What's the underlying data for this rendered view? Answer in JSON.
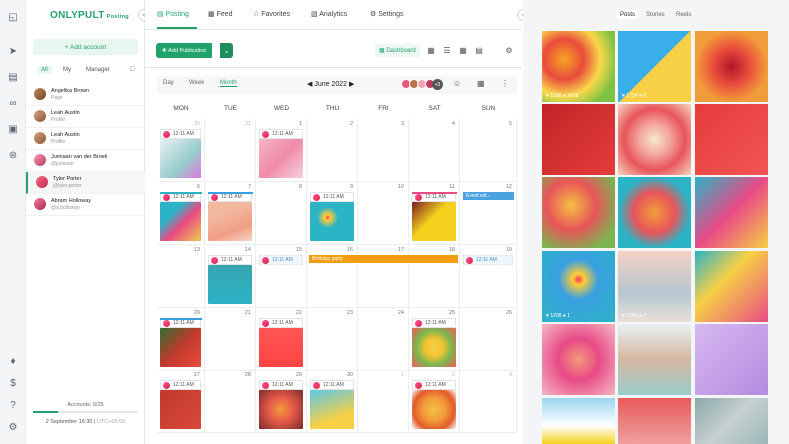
{
  "brand": {
    "name": "ONLYPULT",
    "suffix": "Posting",
    "accent": "#22a36c"
  },
  "rail_icons": [
    "camera-icon",
    "send-icon",
    "analytics-icon",
    "link-icon",
    "monitor-icon",
    "broadcast-icon",
    "bell-icon",
    "dollar-icon",
    "help-icon",
    "settings-icon"
  ],
  "accounts_panel": {
    "add_label": "+ Add account",
    "filters": [
      "All",
      "My",
      "Manager"
    ],
    "items": [
      {
        "name": "Angelika Brown",
        "sub": "Page"
      },
      {
        "name": "Leah Austin",
        "sub": "Profile"
      },
      {
        "name": "Leah Austin",
        "sub": "Profile"
      },
      {
        "name": "Jumiaan van der Broek",
        "sub": "@jumiaan"
      },
      {
        "name": "Tyler Porter",
        "sub": "@tyler.porter"
      },
      {
        "name": "Abram Holloway",
        "sub": "@a.holloway"
      }
    ],
    "footer": {
      "count": "Accounts: 6/25",
      "date": "2 September 16:30",
      "tz": "UTC+05:00"
    }
  },
  "nav": {
    "tabs": [
      {
        "label": "Posting",
        "icon": "posting-icon"
      },
      {
        "label": "Feed",
        "icon": "feed-icon"
      },
      {
        "label": "Favorites",
        "icon": "star-icon"
      },
      {
        "label": "Analytics",
        "icon": "analytics-icon"
      },
      {
        "label": "Settings",
        "icon": "gear-icon"
      }
    ]
  },
  "toolbar": {
    "add_publication": "Add Publication",
    "dashboard": "Dashboard"
  },
  "calendar": {
    "views": [
      "Day",
      "Week",
      "Month"
    ],
    "month_label": "June 2022",
    "extra_accounts": "+3",
    "weekdays": [
      "MON",
      "TUE",
      "WED",
      "THU",
      "FRI",
      "SAT",
      "SUN"
    ],
    "weeks": [
      [
        {
          "d": "30",
          "f": true
        },
        {
          "d": "31",
          "f": true
        },
        {
          "d": "1"
        },
        {
          "d": "2"
        },
        {
          "d": "3"
        },
        {
          "d": "4"
        },
        {
          "d": "5"
        }
      ],
      [
        {
          "d": "6"
        },
        {
          "d": "7"
        },
        {
          "d": "8"
        },
        {
          "d": "9"
        },
        {
          "d": "10"
        },
        {
          "d": "11"
        },
        {
          "d": "12"
        }
      ],
      [
        {
          "d": "13"
        },
        {
          "d": "14"
        },
        {
          "d": "15"
        },
        {
          "d": "16"
        },
        {
          "d": "17"
        },
        {
          "d": "18"
        },
        {
          "d": "19"
        }
      ],
      [
        {
          "d": "20"
        },
        {
          "d": "21"
        },
        {
          "d": "22"
        },
        {
          "d": "23"
        },
        {
          "d": "24"
        },
        {
          "d": "25"
        },
        {
          "d": "26"
        }
      ],
      [
        {
          "d": "27"
        },
        {
          "d": "28"
        },
        {
          "d": "29"
        },
        {
          "d": "30"
        },
        {
          "d": "1",
          "f": true
        },
        {
          "d": "2",
          "f": true
        },
        {
          "d": "3",
          "f": true
        }
      ]
    ],
    "pub_time": "12:11 AM",
    "events": {
      "birthday": "Birthday party",
      "event_mark": "Event wit..."
    }
  },
  "preview": {
    "tabs": [
      "Posts",
      "Stories",
      "Reels"
    ],
    "stats": [
      "♥ 1256  ● 2418",
      "♥ 1724  ● 6",
      "",
      "",
      "",
      "",
      "",
      "",
      "",
      "♥ 1208  ● 1",
      "♥ 1243  ● 2",
      "",
      "",
      "",
      "",
      "",
      "",
      "",
      "",
      "",
      ""
    ]
  }
}
